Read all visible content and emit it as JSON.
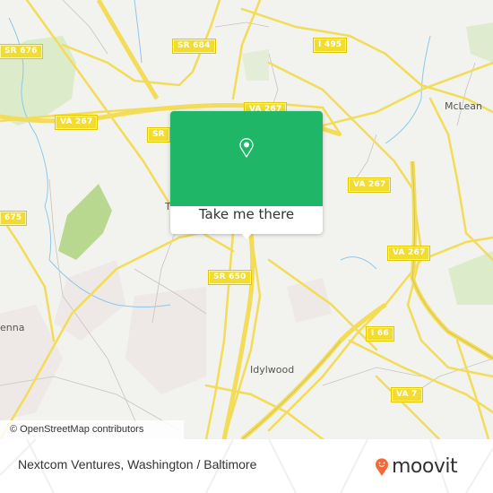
{
  "map": {
    "road_shields": [
      {
        "id": "sr676",
        "label": "SR 676"
      },
      {
        "id": "sr684",
        "label": "SR 684"
      },
      {
        "id": "i495",
        "label": "I 495"
      },
      {
        "id": "va267a",
        "label": "VA 267"
      },
      {
        "id": "va267b",
        "label": "VA 267"
      },
      {
        "id": "sr-partial",
        "label": "SR"
      },
      {
        "id": "va267c",
        "label": "VA 267"
      },
      {
        "id": "va267d",
        "label": "VA 267"
      },
      {
        "id": "sr675",
        "label": "675"
      },
      {
        "id": "sr650",
        "label": "SR 650"
      },
      {
        "id": "i66",
        "label": "I 66"
      },
      {
        "id": "va7",
        "label": "VA 7"
      }
    ],
    "places": [
      {
        "id": "mclean",
        "label": "McLean"
      },
      {
        "id": "vienna",
        "label": "enna"
      },
      {
        "id": "idylwood",
        "label": "Idylwood"
      },
      {
        "id": "tysons",
        "label": "T"
      }
    ],
    "attribution": "© OpenStreetMap contributors"
  },
  "popup": {
    "icon": "map-pin-icon",
    "button_label": "Take me there",
    "color": "#1fb767"
  },
  "footer": {
    "title": "Nextcom Ventures, Washington / Baltimore",
    "brand": "moovit",
    "brand_color": "#f26a3a"
  }
}
